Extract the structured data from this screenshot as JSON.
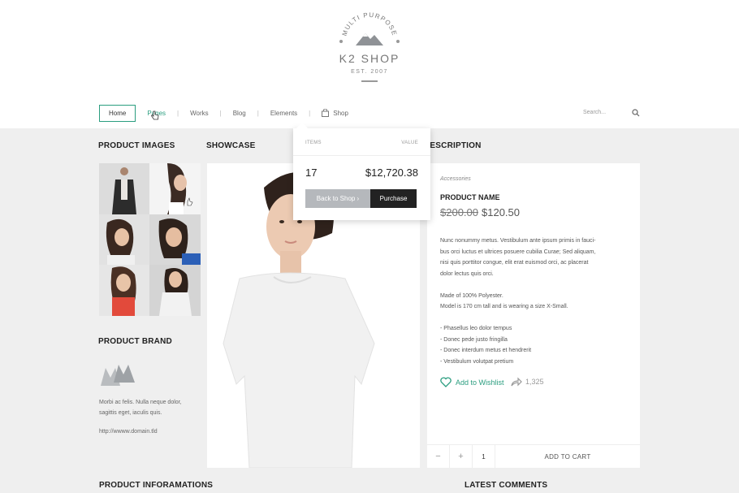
{
  "logo": {
    "tagline": "MULTI PURPOSE",
    "brand": "K2 SHOP",
    "est": "EST. 2007"
  },
  "nav": {
    "items": [
      "Home",
      "Pages",
      "Works",
      "Blog",
      "Elements",
      "Shop"
    ],
    "separator": "|",
    "search_placeholder": "Search..."
  },
  "headings": {
    "product_images": "PRODUCT IMAGES",
    "showcase": "SHOWCASE",
    "description": "DESCRIPTION",
    "product_brand": "PRODUCT BRAND",
    "product_informations": "PRODUCT INFORAMATIONS",
    "latest_comments": "LATEST COMMENTS"
  },
  "brand": {
    "text": "Morbi ac felis. Nulla neque dolor, sagittis eget, iaculis quis.",
    "url": "http://wwww.domain.tld"
  },
  "description": {
    "category": "Accessories",
    "product_name": "PRODUCT NAME",
    "old_price": "$200.00",
    "price": "$120.50",
    "paragraphs": [
      "Nunc nonummy metus. Vestibulum ante ipsum primis in fauci-",
      "bus orci luctus et ultrices posuere cubilia Curae; Sed aliquam,",
      "nisi quis porttitor congue, elit erat euismod orci, ac placerat",
      "dolor lectus quis orci.",
      "",
      "Made of 100% Polyester.",
      "Model is 170 cm tall and is wearing a size X-Small.",
      "",
      "- Phasellus leo dolor tempus",
      "- Donec pede justo fringilla",
      "- Donec interdum metus et hendrerit",
      "- Vestibulum volutpat pretium"
    ],
    "wishlist": "Add to Wishlist",
    "shares": "1,325"
  },
  "cart_bar": {
    "minus": "−",
    "plus": "+",
    "quantity": "1",
    "add_label": "ADD TO CART"
  },
  "dropdown": {
    "items_label": "ITEMS",
    "value_label": "VALUE",
    "count": "17",
    "total": "$12,720.38",
    "back_label": "Back to Shop ›",
    "purchase_label": "Purchase"
  },
  "colors": {
    "accent": "#2a9d7f",
    "dark": "#222222",
    "muted_button": "#b5b8bc",
    "page_bg": "#efefef"
  }
}
